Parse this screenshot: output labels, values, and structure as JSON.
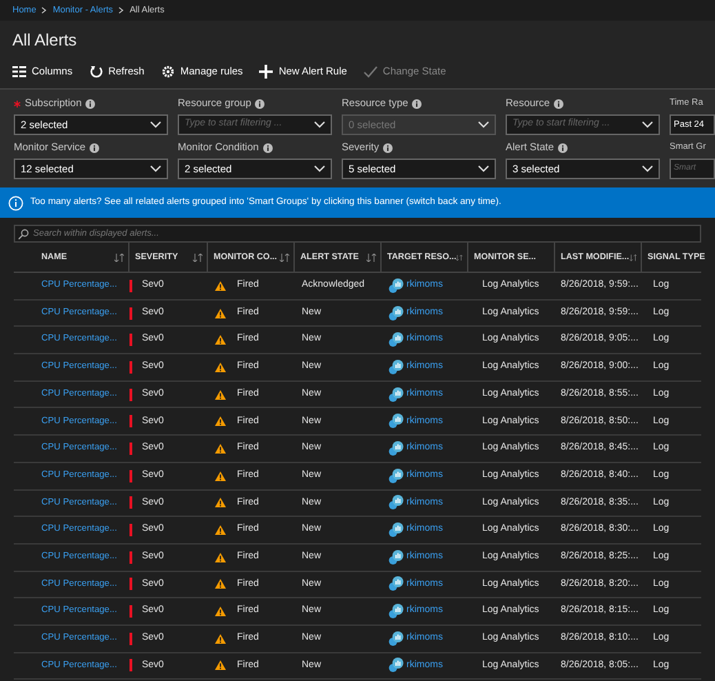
{
  "breadcrumb": [
    "Home",
    "Monitor - Alerts",
    "All Alerts"
  ],
  "title": "All Alerts",
  "toolbar": [
    {
      "kind": "columns",
      "label": "Columns",
      "disabled": false
    },
    {
      "kind": "refresh",
      "label": "Refresh",
      "disabled": false
    },
    {
      "kind": "settings",
      "label": "Manage rules",
      "disabled": false
    },
    {
      "kind": "add",
      "label": "New Alert Rule",
      "disabled": false
    },
    {
      "kind": "state",
      "label": "Change State",
      "disabled": true
    }
  ],
  "filters": [
    [
      {
        "label": "Subscription",
        "required": true,
        "value": "2 selected",
        "disabled": false
      },
      {
        "label": "Resource group",
        "required": false,
        "placeholder": "Type to start filtering ...",
        "disabled": false
      },
      {
        "label": "Resource type",
        "required": false,
        "value": "0 selected",
        "disabled": true
      },
      {
        "label": "Resource",
        "required": false,
        "placeholder": "Type to start filtering ...",
        "disabled": false
      },
      {
        "label": "Time Ra",
        "required": false,
        "value": "Past 24",
        "disabled": false
      }
    ],
    [
      {
        "label": "Monitor Service",
        "required": false,
        "value": "12 selected",
        "disabled": false
      },
      {
        "label": "Monitor Condition",
        "required": false,
        "value": "2 selected",
        "disabled": false
      },
      {
        "label": "Severity",
        "required": false,
        "value": "5 selected",
        "disabled": false
      },
      {
        "label": "Alert State",
        "required": false,
        "value": "3 selected",
        "disabled": false
      },
      {
        "label": "Smart Gr",
        "required": false,
        "placeholder": "Smart",
        "disabled": false
      }
    ]
  ],
  "banner": "Too many alerts? See all related alerts grouped into 'Smart Groups' by clicking this banner (switch back any time).",
  "search": {
    "placeholder": "Search within displayed alerts..."
  },
  "table": {
    "columns": [
      {
        "label": "NAME",
        "sortable": true
      },
      {
        "label": "SEVERITY",
        "sortable": true
      },
      {
        "label": "MONITOR CO...",
        "sortable": true
      },
      {
        "label": "ALERT STATE",
        "sortable": true
      },
      {
        "label": "TARGET RESO...",
        "sortable": true
      },
      {
        "label": "MONITOR SE...",
        "sortable": false
      },
      {
        "label": "LAST MODIFIE...",
        "sortable": true
      },
      {
        "label": "SIGNAL TYPE",
        "sortable": false
      }
    ],
    "rows": [
      {
        "name": "CPU Percentage...",
        "severity": "Sev0",
        "condition": "Fired",
        "state": "Acknowledged",
        "target": "rkimoms",
        "service": "Log Analytics",
        "modified": "8/26/2018, 9:59:...",
        "signal": "Log"
      },
      {
        "name": "CPU Percentage...",
        "severity": "Sev0",
        "condition": "Fired",
        "state": "New",
        "target": "rkimoms",
        "service": "Log Analytics",
        "modified": "8/26/2018, 9:59:...",
        "signal": "Log"
      },
      {
        "name": "CPU Percentage...",
        "severity": "Sev0",
        "condition": "Fired",
        "state": "New",
        "target": "rkimoms",
        "service": "Log Analytics",
        "modified": "8/26/2018, 9:05:...",
        "signal": "Log"
      },
      {
        "name": "CPU Percentage...",
        "severity": "Sev0",
        "condition": "Fired",
        "state": "New",
        "target": "rkimoms",
        "service": "Log Analytics",
        "modified": "8/26/2018, 9:00:...",
        "signal": "Log"
      },
      {
        "name": "CPU Percentage...",
        "severity": "Sev0",
        "condition": "Fired",
        "state": "New",
        "target": "rkimoms",
        "service": "Log Analytics",
        "modified": "8/26/2018, 8:55:...",
        "signal": "Log"
      },
      {
        "name": "CPU Percentage...",
        "severity": "Sev0",
        "condition": "Fired",
        "state": "New",
        "target": "rkimoms",
        "service": "Log Analytics",
        "modified": "8/26/2018, 8:50:...",
        "signal": "Log"
      },
      {
        "name": "CPU Percentage...",
        "severity": "Sev0",
        "condition": "Fired",
        "state": "New",
        "target": "rkimoms",
        "service": "Log Analytics",
        "modified": "8/26/2018, 8:45:...",
        "signal": "Log"
      },
      {
        "name": "CPU Percentage...",
        "severity": "Sev0",
        "condition": "Fired",
        "state": "New",
        "target": "rkimoms",
        "service": "Log Analytics",
        "modified": "8/26/2018, 8:40:...",
        "signal": "Log"
      },
      {
        "name": "CPU Percentage...",
        "severity": "Sev0",
        "condition": "Fired",
        "state": "New",
        "target": "rkimoms",
        "service": "Log Analytics",
        "modified": "8/26/2018, 8:35:...",
        "signal": "Log"
      },
      {
        "name": "CPU Percentage...",
        "severity": "Sev0",
        "condition": "Fired",
        "state": "New",
        "target": "rkimoms",
        "service": "Log Analytics",
        "modified": "8/26/2018, 8:30:...",
        "signal": "Log"
      },
      {
        "name": "CPU Percentage...",
        "severity": "Sev0",
        "condition": "Fired",
        "state": "New",
        "target": "rkimoms",
        "service": "Log Analytics",
        "modified": "8/26/2018, 8:25:...",
        "signal": "Log"
      },
      {
        "name": "CPU Percentage...",
        "severity": "Sev0",
        "condition": "Fired",
        "state": "New",
        "target": "rkimoms",
        "service": "Log Analytics",
        "modified": "8/26/2018, 8:20:...",
        "signal": "Log"
      },
      {
        "name": "CPU Percentage...",
        "severity": "Sev0",
        "condition": "Fired",
        "state": "New",
        "target": "rkimoms",
        "service": "Log Analytics",
        "modified": "8/26/2018, 8:15:...",
        "signal": "Log"
      },
      {
        "name": "CPU Percentage...",
        "severity": "Sev0",
        "condition": "Fired",
        "state": "New",
        "target": "rkimoms",
        "service": "Log Analytics",
        "modified": "8/26/2018, 8:10:...",
        "signal": "Log"
      },
      {
        "name": "CPU Percentage...",
        "severity": "Sev0",
        "condition": "Fired",
        "state": "New",
        "target": "rkimoms",
        "service": "Log Analytics",
        "modified": "8/26/2018, 8:05:...",
        "signal": "Log"
      }
    ]
  }
}
